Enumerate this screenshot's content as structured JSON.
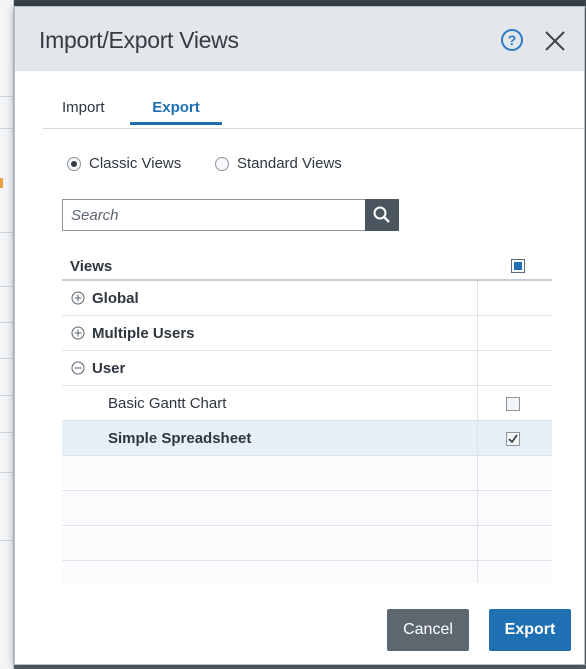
{
  "dialog": {
    "title": "Import/Export Views",
    "help_icon": "help-circle-icon",
    "close_icon": "close-icon"
  },
  "tabs": [
    {
      "label": "Import",
      "active": false
    },
    {
      "label": "Export",
      "active": true
    }
  ],
  "view_type": {
    "options": [
      {
        "label": "Classic Views",
        "selected": true
      },
      {
        "label": "Standard Views",
        "selected": false
      }
    ]
  },
  "search": {
    "placeholder": "Search",
    "value": "",
    "icon": "search-icon"
  },
  "table": {
    "header": "Views",
    "select_all_state": "partial",
    "rows": [
      {
        "label": "Global",
        "type": "group",
        "expanded": false
      },
      {
        "label": "Multiple Users",
        "type": "group",
        "expanded": false
      },
      {
        "label": "User",
        "type": "group",
        "expanded": true
      },
      {
        "label": "Basic Gantt Chart",
        "type": "item",
        "checked": false
      },
      {
        "label": "Simple Spreadsheet",
        "type": "item",
        "checked": true,
        "selected": true
      }
    ]
  },
  "footer": {
    "cancel_label": "Cancel",
    "export_label": "Export"
  },
  "colors": {
    "accent": "#1f6fb3",
    "header_bg": "#e3e7ea",
    "selected_row": "#e7f0f8",
    "secondary_button": "#5d6770"
  }
}
